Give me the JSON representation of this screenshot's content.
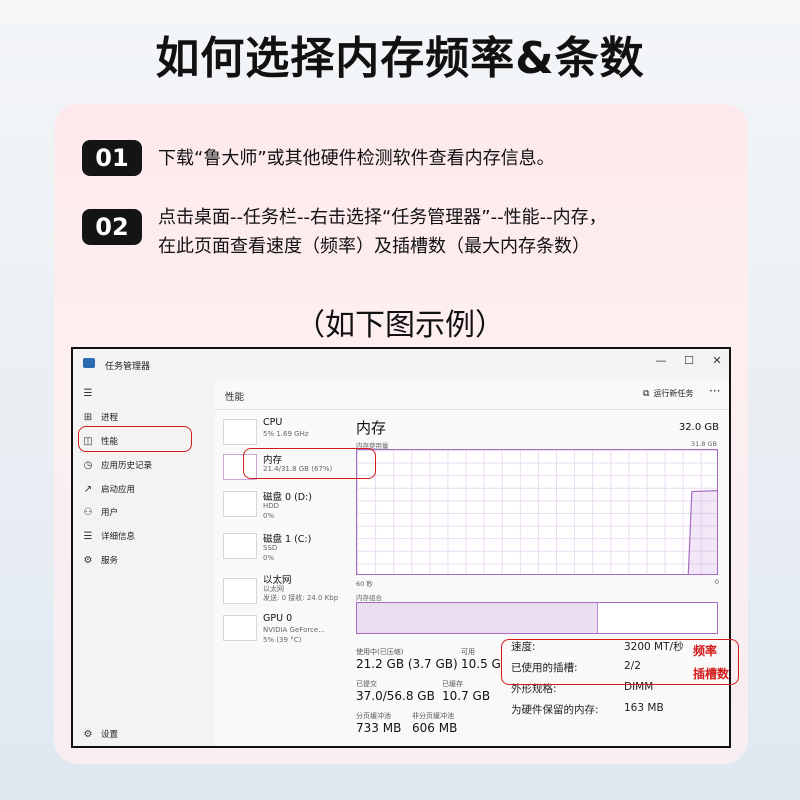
{
  "page": {
    "title": "如何选择内存频率&条数",
    "example_label": "（如下图示例）"
  },
  "steps": [
    {
      "number": "01",
      "lines": [
        "下载“鲁大师”或其他硬件检测软件查看内存信息。"
      ]
    },
    {
      "number": "02",
      "lines": [
        "点击桌面--任务栏--右击选择“任务管理器”--性能--内存，",
        "在此页面查看速度（频率）及插槽数（最大内存条数）"
      ]
    }
  ],
  "task_manager": {
    "window_title": "任务管理器",
    "window_buttons": {
      "minimize": "—",
      "maximize": "☐",
      "close": "✕"
    },
    "nav": {
      "hamburger": "☰",
      "items": [
        {
          "icon": "processes-icon",
          "glyph": "⊞",
          "label": "进程"
        },
        {
          "icon": "performance-icon",
          "glyph": "◫",
          "label": "性能"
        },
        {
          "icon": "app-history-icon",
          "glyph": "◷",
          "label": "应用历史记录"
        },
        {
          "icon": "startup-icon",
          "glyph": "↗",
          "label": "启动应用"
        },
        {
          "icon": "users-icon",
          "glyph": "⚇",
          "label": "用户"
        },
        {
          "icon": "details-icon",
          "glyph": "☰",
          "label": "详细信息"
        },
        {
          "icon": "services-icon",
          "glyph": "⚙",
          "label": "服务"
        }
      ],
      "settings": {
        "icon": "settings-icon",
        "glyph": "⚙",
        "label": "设置"
      }
    },
    "header": {
      "title": "性能",
      "run_new_task": "运行新任务",
      "more": "···"
    },
    "perf_list": [
      {
        "name": "CPU",
        "sub1": "5% 1.69 GHz",
        "sub2": ""
      },
      {
        "name": "内存",
        "sub1": "21.4/31.8 GB (67%)",
        "sub2": ""
      },
      {
        "name": "磁盘 0 (D:)",
        "sub1": "HDD",
        "sub2": "0%"
      },
      {
        "name": "磁盘 1 (C:)",
        "sub1": "SSD",
        "sub2": "0%"
      },
      {
        "name": "以太网",
        "sub1": "以太网",
        "sub2": "发送: 0 接收: 24.0 Kbp"
      },
      {
        "name": "GPU 0",
        "sub1": "NVIDIA GeForce...",
        "sub2": "5% (39 °C)"
      }
    ],
    "memory": {
      "title": "内存",
      "total": "32.0 GB",
      "usage_label": "内存使用量",
      "usage_max": "31.8 GB",
      "axis_left": "60 秒",
      "axis_right": "0",
      "composition_label": "内存组合",
      "composition_fill": 0.67,
      "usage_fraction": 0.67,
      "stats": {
        "in_use_label": "使用中(已压缩)",
        "in_use_value": "21.2 GB (3.7 GB)",
        "available_label": "可用",
        "available_value": "10.5 G",
        "committed_label": "已提交",
        "committed_value": "37.0/56.8 GB",
        "cached_label": "已缓存",
        "cached_value": "10.7 GB",
        "paged_label": "分页缓冲池",
        "paged_value": "733 MB",
        "nonpaged_label": "非分页缓冲池",
        "nonpaged_value": "606 MB"
      },
      "specs": [
        {
          "label": "速度:",
          "value": "3200 MT/秒"
        },
        {
          "label": "已使用的插槽:",
          "value": "2/2"
        },
        {
          "label": "外形规格:",
          "value": "DIMM"
        },
        {
          "label": "为硬件保留的内存:",
          "value": "163 MB"
        }
      ]
    }
  },
  "annotations": {
    "freq": "频率",
    "slots": "插槽数"
  },
  "colors": {
    "accent_red": "#d41c1c",
    "memory_purple": "#a86bc4",
    "badge_bg": "#141414"
  }
}
